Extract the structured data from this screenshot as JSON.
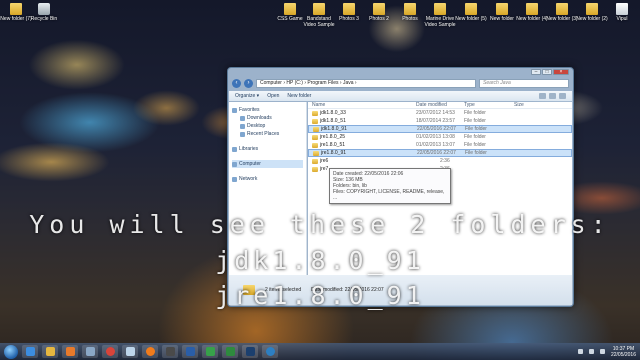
{
  "desktop_icons": [
    {
      "label": "New folder (7)",
      "kind": "folder"
    },
    {
      "label": "Recycle Bin",
      "kind": "bin"
    },
    {
      "label": "CSS Game",
      "kind": "folder"
    },
    {
      "label": "Bandstand Video Sample",
      "kind": "folder"
    },
    {
      "label": "Photos 3",
      "kind": "folder"
    },
    {
      "label": "Photos 2",
      "kind": "folder"
    },
    {
      "label": "Photos",
      "kind": "folder"
    },
    {
      "label": "Marine Drive Video Sample",
      "kind": "folder"
    },
    {
      "label": "New folder (5)",
      "kind": "folder"
    },
    {
      "label": "New folder",
      "kind": "folder"
    },
    {
      "label": "New folder (4)",
      "kind": "folder"
    },
    {
      "label": "New folder (3)",
      "kind": "folder"
    },
    {
      "label": "New folder (2)",
      "kind": "folder"
    },
    {
      "label": "Vipul",
      "kind": "folder"
    }
  ],
  "explorer": {
    "address": "Computer › HP (C:) › Program Files › Java ›",
    "search_placeholder": "Search Java",
    "toolbar": {
      "organize": "Organize ▾",
      "open": "Open",
      "new_folder": "New folder"
    },
    "nav": {
      "favorites": "Favorites",
      "downloads": "Downloads",
      "desktop": "Desktop",
      "recent": "Recent Places",
      "libraries": "Libraries",
      "computer": "Computer",
      "network": "Network"
    },
    "columns": {
      "name": "Name",
      "date": "Date modified",
      "type": "Type",
      "size": "Size"
    },
    "rows": [
      {
        "name": "jdk1.8.0_33",
        "date": "23/07/2012 14:53",
        "type": "File folder",
        "selected": false
      },
      {
        "name": "jdk1.8.0_51",
        "date": "18/07/2014 23:57",
        "type": "File folder",
        "selected": false
      },
      {
        "name": "jdk1.8.0_91",
        "date": "22/05/2016 22:07",
        "type": "File folder",
        "selected": true
      },
      {
        "name": "jre1.8.0_25",
        "date": "01/02/2013 13:08",
        "type": "File folder",
        "selected": false
      },
      {
        "name": "jre1.8.0_51",
        "date": "01/02/2013 13:07",
        "type": "File folder",
        "selected": false
      },
      {
        "name": "jre1.8.0_91",
        "date": "22/05/2016 22:07",
        "type": "File folder",
        "selected": true
      },
      {
        "name": "jre6",
        "date": "",
        "type": "",
        "selected": false
      },
      {
        "name": "jre7",
        "date": "",
        "type": "",
        "selected": false
      }
    ],
    "row_dates_partial": {
      "jre6": "2:36",
      "jre7": "2:36"
    },
    "tooltip": {
      "created": "Date created: 22/05/2016 22:06",
      "size": "Size: 136 MB",
      "folders": "Folders: bin, lib",
      "files": "Files: COPYRIGHT, LICENSE, README, release, ..."
    },
    "status": {
      "selected": "2 items selected",
      "date": "Date modified: 22/05/2016 22:07"
    }
  },
  "overlay": {
    "line1": "You will see these 2 folders:",
    "line2": "jdk1.8.0_91",
    "line3": "jre1.8.0_91"
  },
  "taskbar": {
    "time": "10:37 PM",
    "date": "22/05/2016"
  }
}
